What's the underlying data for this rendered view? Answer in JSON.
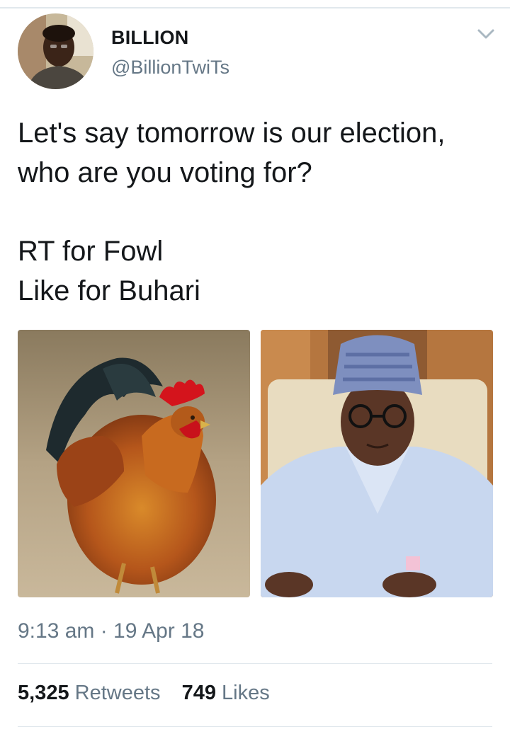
{
  "user": {
    "display_name": "BILLION",
    "handle": "@BillionTwiTs"
  },
  "tweet": {
    "lines": [
      "Let's say tomorrow is our election,",
      "who are you voting for?",
      "RT for Fowl",
      "Like for Buhari"
    ]
  },
  "media": [
    {
      "icon": "rooster-photo"
    },
    {
      "icon": "man-in-cap-photo"
    }
  ],
  "meta": {
    "timestamp": "9:13 am · 19 Apr 18"
  },
  "stats": {
    "retweets_count": "5,325",
    "retweets_label": "Retweets",
    "likes_count": "749",
    "likes_label": "Likes"
  },
  "colors": {
    "text": "#14171a",
    "secondary": "#657786",
    "divider": "#e1e8ed"
  }
}
